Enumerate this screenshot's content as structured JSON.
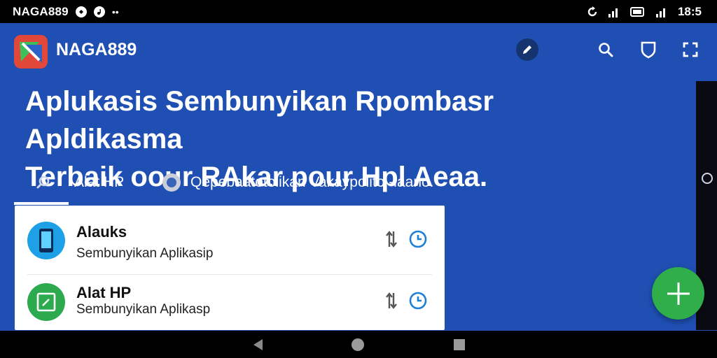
{
  "status_bar": {
    "brand": "NAGA889",
    "time": "18:5",
    "icons": [
      "sync-icon",
      "signal-icon",
      "battery-icon",
      "signal-icon"
    ]
  },
  "app": {
    "name": "NAGA889",
    "logo": "naga889-logo",
    "colors": {
      "background": "#1f4fb2",
      "accent_green": "#2fae4a",
      "logo_red": "#e2483a"
    }
  },
  "header_icons": [
    "edit-icon",
    "search-icon",
    "shield-icon",
    "fullscreen-icon"
  ],
  "headline": {
    "line1": "Aplukasis Sembunyikan Rpombasr Apldikasma",
    "line2": "Terbaik oour RAkar pour Hpl Aeaa."
  },
  "tabs": [
    {
      "label": "Alat HP",
      "icon": "search-icon",
      "selected": true
    },
    {
      "label": "Qepebaatotolikan Vakaypolito -laano.",
      "icon": "radio-icon",
      "selected": false
    }
  ],
  "list": [
    {
      "title": "Alauks",
      "subtitle": "Sembunyikan Aplikasip",
      "icon": "phone-icon",
      "icon_color": "#1ea0e6"
    },
    {
      "title": "Alat HP",
      "subtitle": "Sembunyikan Aplikasp",
      "icon": "tablet-icon",
      "icon_color": "#2eaa4e"
    }
  ],
  "fab": {
    "icon": "plus-icon"
  },
  "nav": [
    "back-icon",
    "home-icon",
    "recents-icon"
  ]
}
